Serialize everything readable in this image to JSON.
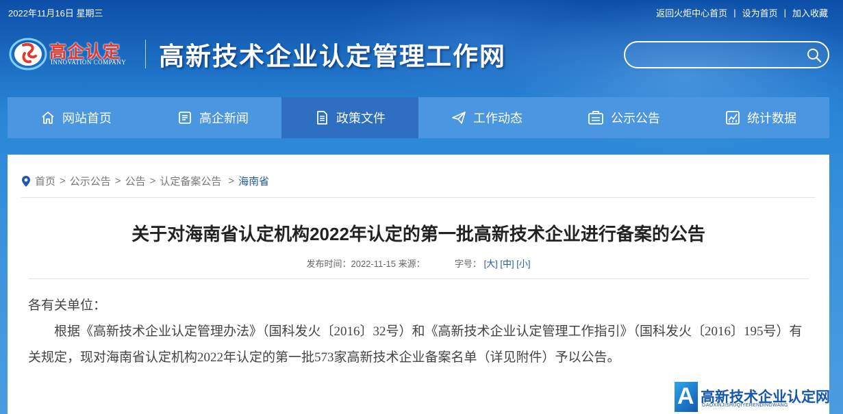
{
  "topbar": {
    "date": "2022年11月16日 星期三",
    "links": [
      "返回火炬中心首页",
      "设为首页",
      "加入收藏"
    ],
    "separator": "|"
  },
  "header": {
    "logo_cn": "高企认定",
    "logo_en": "INNOVATION COMPANY",
    "site_title": "高新技术企业认定管理工作网",
    "search_placeholder": ""
  },
  "nav": {
    "items": [
      {
        "label": "网站首页",
        "icon": "home-icon",
        "active": false
      },
      {
        "label": "高企新闻",
        "icon": "news-icon",
        "active": false
      },
      {
        "label": "政策文件",
        "icon": "document-icon",
        "active": true
      },
      {
        "label": "工作动态",
        "icon": "paper-plane-icon",
        "active": false
      },
      {
        "label": "公示公告",
        "icon": "notice-icon",
        "active": false
      },
      {
        "label": "统计数据",
        "icon": "chart-icon",
        "active": false
      }
    ]
  },
  "breadcrumb": {
    "items": [
      "首页",
      "公示公告",
      "公告",
      "认定备案公告"
    ],
    "current": "海南省",
    "separator": ">"
  },
  "article": {
    "title": "关于对海南省认定机构2022年认定的第一批高新技术企业进行备案的公告",
    "meta_publish_label": "发布时间：",
    "meta_publish_date": "2022-11-15",
    "meta_source_label": "来源：",
    "meta_size_label": "字号：",
    "size_large": "[大]",
    "size_medium": "[中]",
    "size_small": "[小]",
    "salutation": "各有关单位：",
    "paragraph": "根据《高新技术企业认定管理办法》（国科发火〔2016〕32号）和《高新技术企业认定管理工作指引》（国科发火〔2016〕195号）有关规定，现对海南省认定机构2022年认定的第一批573家高新技术企业备案名单（详见附件）予以公告。"
  },
  "watermark": {
    "letter": "A",
    "cn": "高新技术企业认定网",
    "en": "GAOXINJISHUQIYERENDINGWANG"
  },
  "colors": {
    "nav_bg": "#4a96e0",
    "nav_active": "#2e6fc2",
    "link_blue": "#1f5aa8",
    "logo_red": "#e23a2a"
  }
}
